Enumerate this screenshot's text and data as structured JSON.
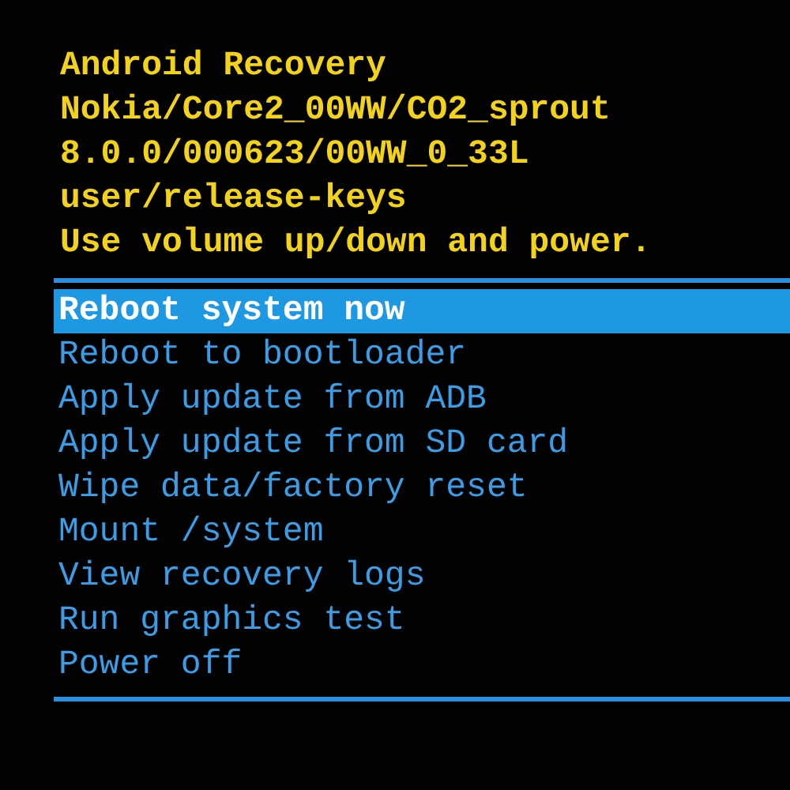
{
  "header_lines": [
    "Android Recovery",
    "Nokia/Core2_00WW/CO2_sprout",
    "8.0.0/000623/00WW_0_33L",
    "user/release-keys",
    "Use volume up/down and power."
  ],
  "menu": [
    {
      "label": "Reboot system now",
      "selected": true
    },
    {
      "label": "Reboot to bootloader",
      "selected": false
    },
    {
      "label": "Apply update from ADB",
      "selected": false
    },
    {
      "label": "Apply update from SD card",
      "selected": false
    },
    {
      "label": "Wipe data/factory reset",
      "selected": false
    },
    {
      "label": "Mount /system",
      "selected": false
    },
    {
      "label": "View recovery logs",
      "selected": false
    },
    {
      "label": "Run graphics test",
      "selected": false
    },
    {
      "label": "Power off",
      "selected": false
    }
  ]
}
